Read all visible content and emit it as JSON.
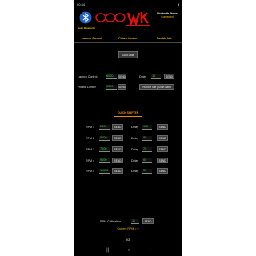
{
  "status_bar": {
    "time": "00:34"
  },
  "header": {
    "bluetooth_label": "Scan Bluetooth",
    "bt_status_title": "Bluetooth Status",
    "bt_status_value": "Connected"
  },
  "tabs": [
    {
      "label": "Launch Control"
    },
    {
      "label": "Pitlane Limiter"
    },
    {
      "label": "Rumble Idle"
    }
  ],
  "load_button": "Load Data",
  "launch_control": {
    "label": "Launch Control",
    "value": "6000",
    "button": "SEND",
    "delay_label": "Delay",
    "delay_value": "10",
    "delay_button": "SEND"
  },
  "pitlane": {
    "label": "Pitlane Limiter",
    "value": "5000",
    "button": "SEND",
    "rumble_button": "Rumble Idle | Short Band"
  },
  "quickshifter": {
    "title": "QUICK SHIFTER",
    "rows": [
      {
        "label": "RPM 1",
        "rpm": "2500",
        "rpm_button": "SEND",
        "delay_label": "Delay",
        "delay": "110",
        "delay_button": "SEND"
      },
      {
        "label": "RPM 2",
        "rpm": "5000",
        "rpm_button": "SEND",
        "delay_label": "Delay",
        "delay": "80",
        "delay_button": "SEND"
      },
      {
        "label": "RPM 3",
        "rpm": "7000",
        "rpm_button": "SEND",
        "delay_label": "Delay",
        "delay": "70",
        "delay_button": "SEND"
      },
      {
        "label": "RPM 4",
        "rpm": "9000",
        "rpm_button": "SEND",
        "delay_label": "Delay",
        "delay": "60",
        "delay_button": "SEND"
      },
      {
        "label": "RPM 5",
        "rpm": "11000",
        "rpm_button": "SEND",
        "delay_label": "Delay",
        "delay": "50",
        "delay_button": "SEND"
      }
    ]
  },
  "rpm_calibration": {
    "label": "RPM Calibration",
    "value": "11",
    "button": "SEND"
  },
  "current_rpm": {
    "label": "Current RPM =",
    "value": "0"
  },
  "version": "V2",
  "colors": {
    "accent": "#f0c000",
    "value_green": "#3cd03c",
    "logo_red": "#e01010",
    "section_orange": "#f08a00"
  }
}
